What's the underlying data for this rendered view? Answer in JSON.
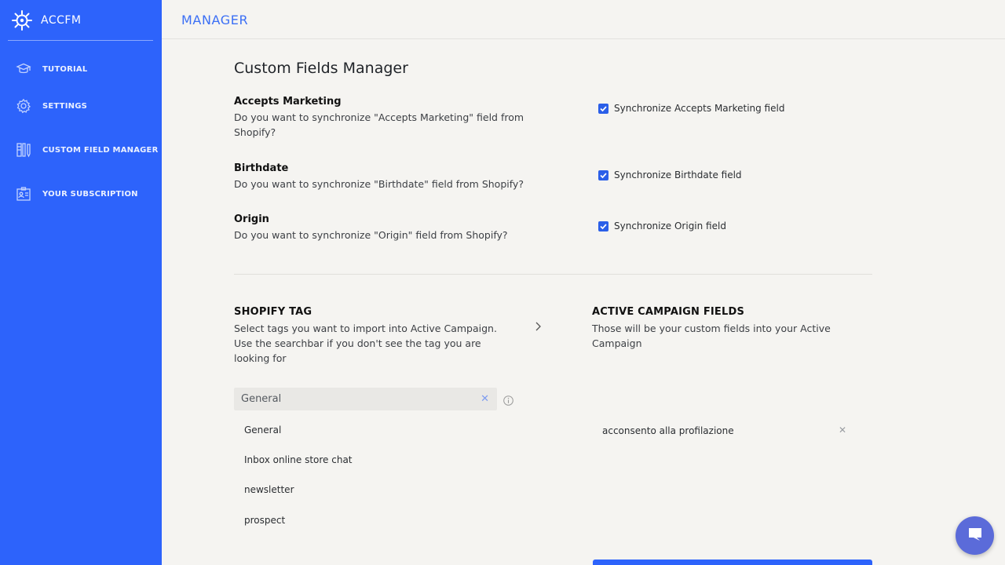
{
  "sidebar": {
    "brand": "ACCFM",
    "items": [
      {
        "label": "TUTORIAL",
        "icon": "graduation-cap-icon"
      },
      {
        "label": "SETTINGS",
        "icon": "gear-icon"
      },
      {
        "label": "CUSTOM FIELD MANAGER",
        "icon": "columns-pencil-icon"
      },
      {
        "label": "YOUR SUBSCRIPTION",
        "icon": "id-card-icon"
      }
    ]
  },
  "header": {
    "title": "MANAGER"
  },
  "main": {
    "title": "Custom Fields Manager",
    "fields": [
      {
        "name": "Accepts Marketing",
        "description": "Do you want to synchronize \"Accepts Marketing\" field from Shopify?",
        "checkbox_label": "Synchronize Accepts Marketing field",
        "checked": true
      },
      {
        "name": "Birthdate",
        "description": "Do you want to synchronize \"Birthdate\" field from Shopify?",
        "checkbox_label": "Synchronize Birthdate field",
        "checked": true
      },
      {
        "name": "Origin",
        "description": "Do you want to synchronize \"Origin\" field from Shopify?",
        "checkbox_label": "Synchronize Origin field",
        "checked": true
      }
    ],
    "shopify": {
      "heading": "SHOPIFY TAG",
      "description": "Select tags you want to import into Active Campaign. Use the searchbar if you don't see the tag you are looking for",
      "select_value": "General",
      "options": [
        "General",
        "Inbox online store chat",
        "newsletter",
        "prospect"
      ]
    },
    "active_campaign": {
      "heading": "ACTIVE CAMPAIGN FIELDS",
      "description": "Those will be your custom fields into your Active Campaign",
      "fields": [
        "acconsento alla profilazione"
      ]
    }
  },
  "colors": {
    "sidebar": "#2d63fb",
    "accent": "#3b6ff5",
    "checkbox": "#2b5fe8",
    "chat": "#5b6bd9"
  }
}
